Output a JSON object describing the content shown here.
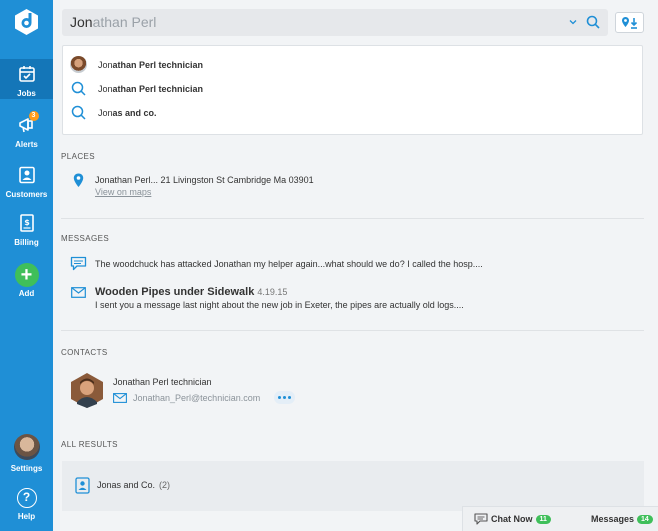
{
  "sidebar": {
    "items": [
      {
        "label": "Jobs",
        "icon": "calendar-check-icon",
        "active": true
      },
      {
        "label": "Alerts",
        "icon": "megaphone-icon",
        "badge": "3"
      },
      {
        "label": "Customers",
        "icon": "contact-card-icon"
      },
      {
        "label": "Billing",
        "icon": "invoice-icon"
      },
      {
        "label": "Add",
        "icon": "plus-icon"
      }
    ],
    "settings_label": "Settings",
    "help_label": "Help",
    "help_glyph": "?",
    "add_glyph": "+"
  },
  "search": {
    "typed": "Jon",
    "rest": "athan Perl"
  },
  "suggestions": [
    {
      "bold": "Jon",
      "rest": "athan Perl technician",
      "icon": "avatar"
    },
    {
      "bold": "Jon",
      "rest": "athan Perl technician",
      "icon": "search-icon"
    },
    {
      "bold": "Jon",
      "rest": "as and co.",
      "icon": "search-icon"
    }
  ],
  "places": {
    "title": "PLACES",
    "address": "Jonathan Perl... 21 Livingston St Cambridge Ma 03901",
    "link": "View on maps"
  },
  "messages": {
    "title": "MESSAGES",
    "items": [
      {
        "text": "The woodchuck has attacked Jonathan my helper again...what should we do? I called the hosp....",
        "icon": "chat-bubble-icon"
      },
      {
        "subject": "Wooden Pipes under Sidewalk",
        "date": "4.19.15",
        "text": "I sent you a message last night about the new job in Exeter, the pipes are actually old logs....",
        "icon": "envelope-icon"
      }
    ]
  },
  "contacts": {
    "title": "CONTACTS",
    "name": "Jonathan Perl technician",
    "email": "Jonathan_Perl@technician.com"
  },
  "all_results": {
    "title": "ALL RESULTS",
    "item_label": "Jonas and Co.",
    "item_count": "(2)"
  },
  "bottom": {
    "chat_label": "Chat Now",
    "chat_count": "11",
    "messages_label": "Messages",
    "messages_count": "14"
  },
  "colors": {
    "sidebar": "#1f8fd6",
    "sidebar_active": "#1476b8",
    "accent": "#1f8fd6",
    "badge": "#ff9c1a",
    "green": "#3fbf5a"
  }
}
